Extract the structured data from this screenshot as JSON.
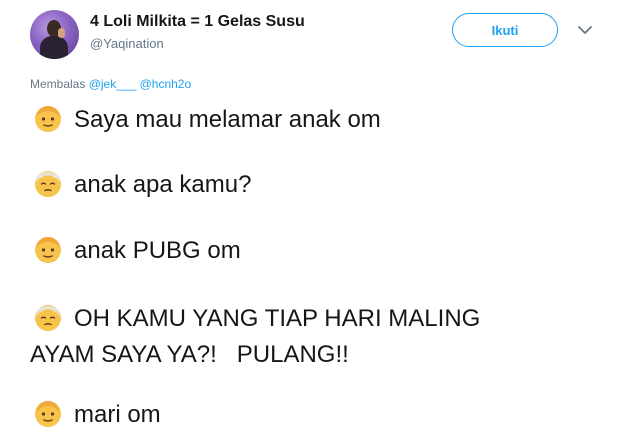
{
  "tweet": {
    "display_name": "4 Loli Milkita = 1 Gelas Susu",
    "handle": "@Yaqination",
    "follow_label": "Ikuti",
    "reply_prefix": "Membalas",
    "reply_mentions": [
      "@jek___",
      "@hcnh2o"
    ],
    "lines": [
      {
        "emoji": "boy-emoji",
        "text": "Saya mau melamar anak om"
      },
      {
        "emoji": "old-man-emoji",
        "text": "anak apa kamu?"
      },
      {
        "emoji": "boy-emoji",
        "text": "anak PUBG om"
      },
      {
        "emoji": "old-man-emoji",
        "text": "OH KAMU YANG TIAP HARI MALING\nAYAM SAYA YA?!   PULANG!!"
      },
      {
        "emoji": "boy-emoji",
        "text": "mari om"
      }
    ]
  },
  "colors": {
    "accent": "#1da1f2",
    "secondary_text": "#657786",
    "primary_text": "#14171a",
    "emoji_yellow": "#f7c34a"
  },
  "icons": {
    "chevron": "chevron-down-icon"
  }
}
